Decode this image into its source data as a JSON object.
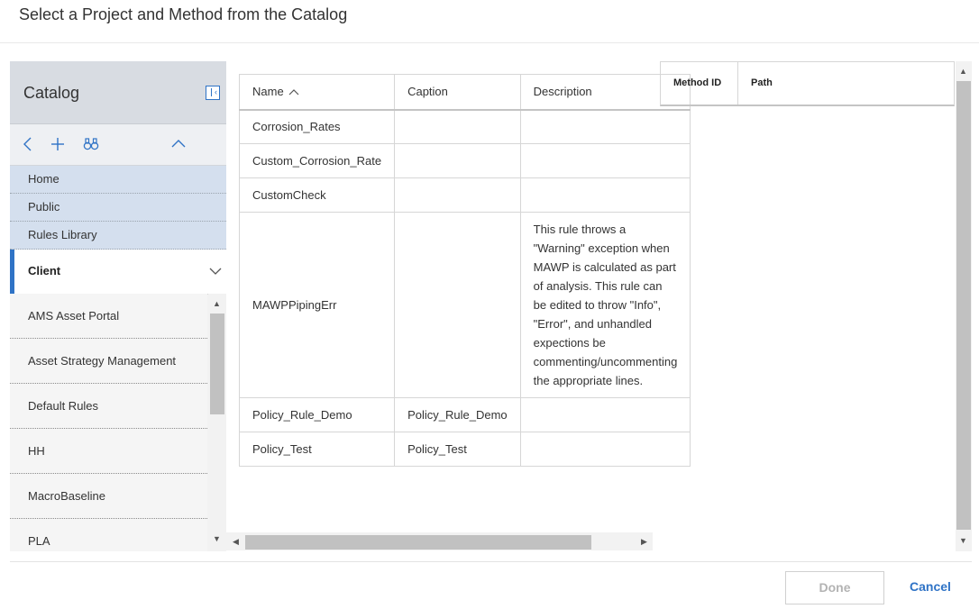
{
  "dialog": {
    "title": "Select a Project and Method from the Catalog"
  },
  "catalog": {
    "title": "Catalog",
    "breadcrumbs": [
      "Home",
      "Public",
      "Rules Library"
    ],
    "selected": "Client",
    "items": [
      "AMS Asset Portal",
      "Asset Strategy Management",
      "Default Rules",
      "HH",
      "MacroBaseline",
      "PLA"
    ]
  },
  "grid": {
    "columns": {
      "name": "Name",
      "caption": "Caption",
      "description": "Description"
    },
    "rows": [
      {
        "name": "Corrosion_Rates",
        "caption": "",
        "description": ""
      },
      {
        "name": "Custom_Corrosion_Rate",
        "caption": "",
        "description": ""
      },
      {
        "name": "CustomCheck",
        "caption": "",
        "description": ""
      },
      {
        "name": "MAWPPipingErr",
        "caption": "",
        "description": "This rule throws a \"Warning\" exception when MAWP is calculated as part of analysis. This rule can be edited to throw \"Info\", \"Error\", and unhandled expections be commenting/uncommenting the appropriate lines."
      },
      {
        "name": "Policy_Rule_Demo",
        "caption": "Policy_Rule_Demo",
        "description": ""
      },
      {
        "name": "Policy_Test",
        "caption": "Policy_Test",
        "description": ""
      }
    ]
  },
  "right_grid": {
    "columns": {
      "method_id": "Method ID",
      "path": "Path"
    }
  },
  "footer": {
    "done_label": "Done",
    "cancel_label": "Cancel"
  },
  "colors": {
    "accent": "#2f73c6",
    "breadcrumb_bg": "#d4dfee",
    "header_bg": "#d8dce2"
  }
}
